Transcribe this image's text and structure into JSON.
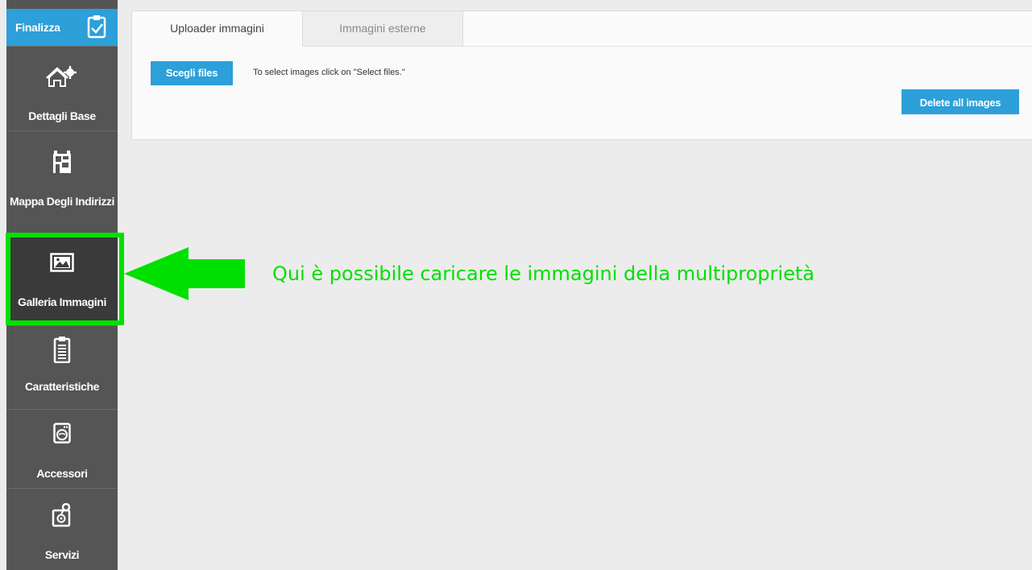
{
  "sidebar": {
    "finalize_label": "Finalizza",
    "items": [
      {
        "label": "Dettagli Base",
        "icon": "home-gear-icon"
      },
      {
        "label": "Mappa Degli Indirizzi",
        "icon": "map-icon"
      },
      {
        "label": "Galleria Immagini",
        "icon": "image-gallery-icon",
        "active": true
      },
      {
        "label": "Caratteristiche",
        "icon": "clipboard-list-icon"
      },
      {
        "label": "Accessori",
        "icon": "washing-machine-icon"
      },
      {
        "label": "Servizi",
        "icon": "service-icon"
      }
    ]
  },
  "tabs": [
    {
      "label": "Uploader immagini",
      "active": true
    },
    {
      "label": "Immagini esterne",
      "active": false
    }
  ],
  "uploader": {
    "choose_label": "Scegli files",
    "hint": "To select images click on \"Select files.\"",
    "delete_label": "Delete all images"
  },
  "annotation": {
    "text": "Qui è possibile caricare le immagini della multiproprietà",
    "color": "#00e000"
  },
  "colors": {
    "accent": "#2d9fd9",
    "sidebar": "#555555",
    "highlight": "#00e000"
  }
}
